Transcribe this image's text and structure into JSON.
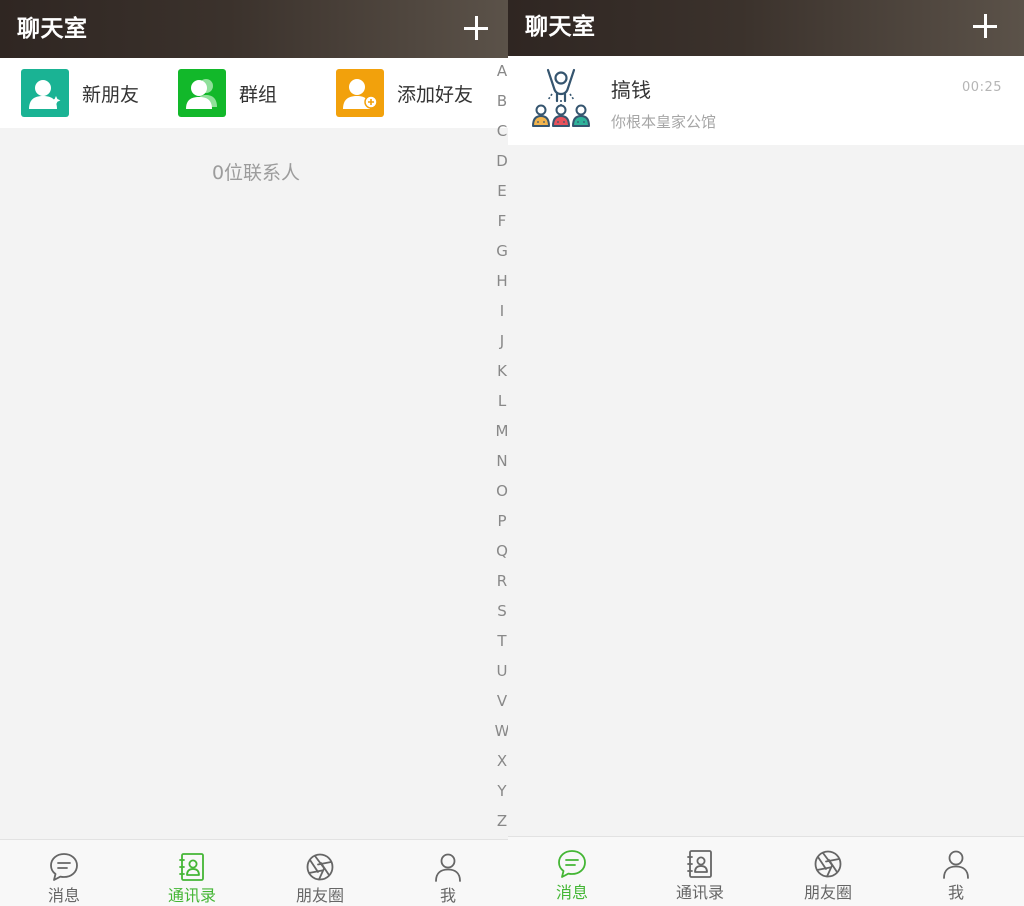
{
  "left_screen": {
    "header": {
      "title": "聊天室"
    },
    "shortcuts": [
      {
        "label": "新朋友",
        "icon": "new-friend-icon",
        "color": "#1ab394"
      },
      {
        "label": "群组",
        "icon": "group-icon",
        "color": "#12b82a"
      },
      {
        "label": "添加好友",
        "icon": "add-friend-icon",
        "color": "#f2a10c"
      }
    ],
    "contact_count": "0位联系人",
    "alpha_index": [
      "A",
      "B",
      "C",
      "D",
      "E",
      "F",
      "G",
      "H",
      "I",
      "J",
      "K",
      "L",
      "M",
      "N",
      "O",
      "P",
      "Q",
      "R",
      "S",
      "T",
      "U",
      "V",
      "W",
      "X",
      "Y",
      "Z"
    ],
    "tabbar": {
      "tabs": [
        {
          "label": "消息",
          "icon": "chat-bubble-icon",
          "active": false
        },
        {
          "label": "通讯录",
          "icon": "contacts-book-icon",
          "active": true
        },
        {
          "label": "朋友圈",
          "icon": "moments-aperture-icon",
          "active": false
        },
        {
          "label": "我",
          "icon": "person-icon",
          "active": false
        }
      ]
    }
  },
  "right_screen": {
    "header": {
      "title": "聊天室"
    },
    "chats": [
      {
        "name": "搞钱",
        "preview": "你根本皇家公馆",
        "time": "00:25",
        "avatar_icon": "group-cheer-icon"
      }
    ],
    "tabbar": {
      "tabs": [
        {
          "label": "消息",
          "icon": "chat-bubble-icon",
          "active": true
        },
        {
          "label": "通讯录",
          "icon": "contacts-book-icon",
          "active": false
        },
        {
          "label": "朋友圈",
          "icon": "moments-aperture-icon",
          "active": false
        },
        {
          "label": "我",
          "icon": "person-icon",
          "active": false
        }
      ]
    }
  },
  "colors": {
    "header_dark": "#2f2622",
    "accent_green": "#44b635",
    "inactive_tab": "#666666",
    "background": "#f3f3f3"
  }
}
